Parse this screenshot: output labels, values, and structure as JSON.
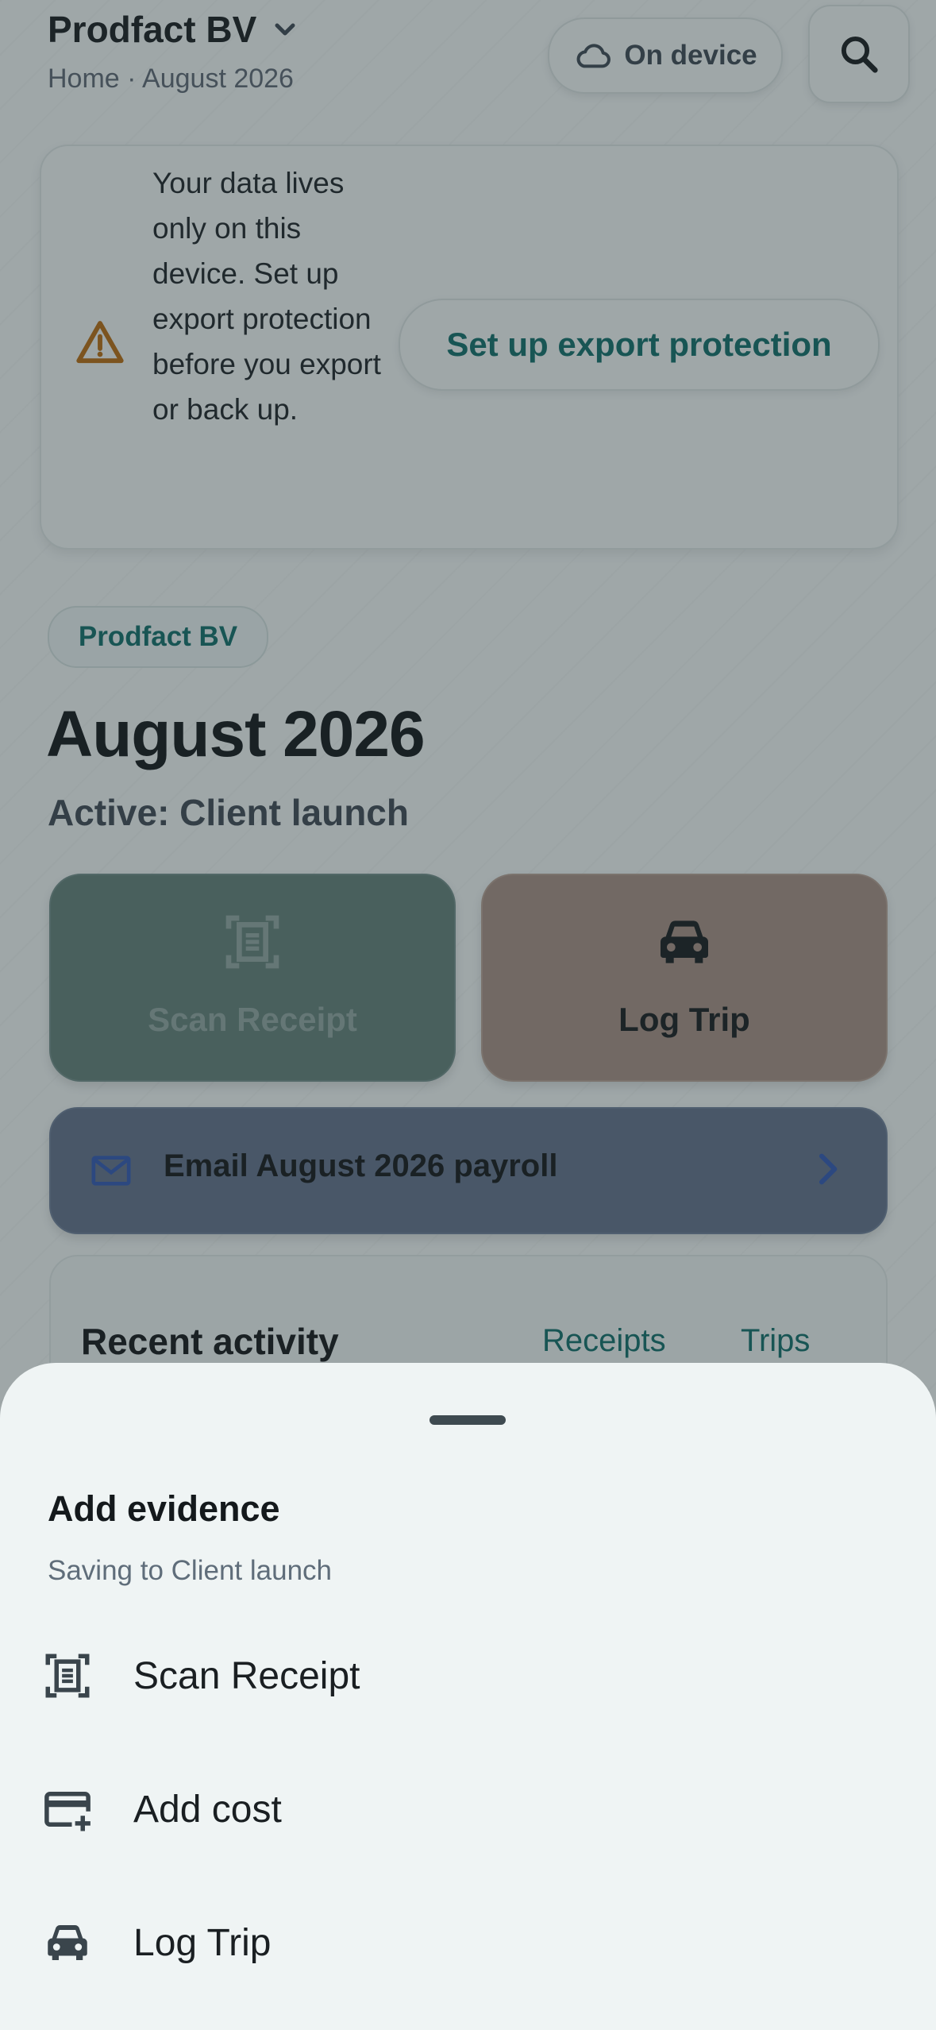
{
  "header": {
    "org_name": "Prodfact BV",
    "breadcrumb": "Home · August 2026",
    "storage_chip": "On device",
    "icons": {
      "org_dropdown": "chevron-down-icon",
      "storage": "cloud-icon",
      "search": "search-icon"
    }
  },
  "warning": {
    "message": "Your data lives only on this device. Set up export protection before you export or back up.",
    "action_label": "Set up export protection",
    "icon": "warning-icon",
    "color": "#b4690e"
  },
  "overview": {
    "company_chip": "Prodfact BV",
    "month_title": "August 2026",
    "active_line": "Active: Client launch"
  },
  "tiles": {
    "scan_label": "Scan Receipt",
    "trip_label": "Log Trip"
  },
  "payroll": {
    "label": "Email August 2026 payroll",
    "icon": "mail-icon"
  },
  "recent": {
    "title": "Recent activity",
    "tabs": [
      "Receipts",
      "Trips"
    ]
  },
  "sheet": {
    "title": "Add evidence",
    "subtitle": "Saving to Client launch",
    "items": [
      {
        "label": "Scan Receipt",
        "icon": "document-scan-icon"
      },
      {
        "label": "Add cost",
        "icon": "card-add-icon"
      },
      {
        "label": "Log Trip",
        "icon": "car-icon"
      }
    ]
  },
  "colors": {
    "accent_teal": "#0e6b67",
    "scan_tile": "#5f7d76",
    "trip_tile": "#a48d80",
    "payroll_row": "#5f6f88",
    "mail_icon": "#2f56b0"
  }
}
